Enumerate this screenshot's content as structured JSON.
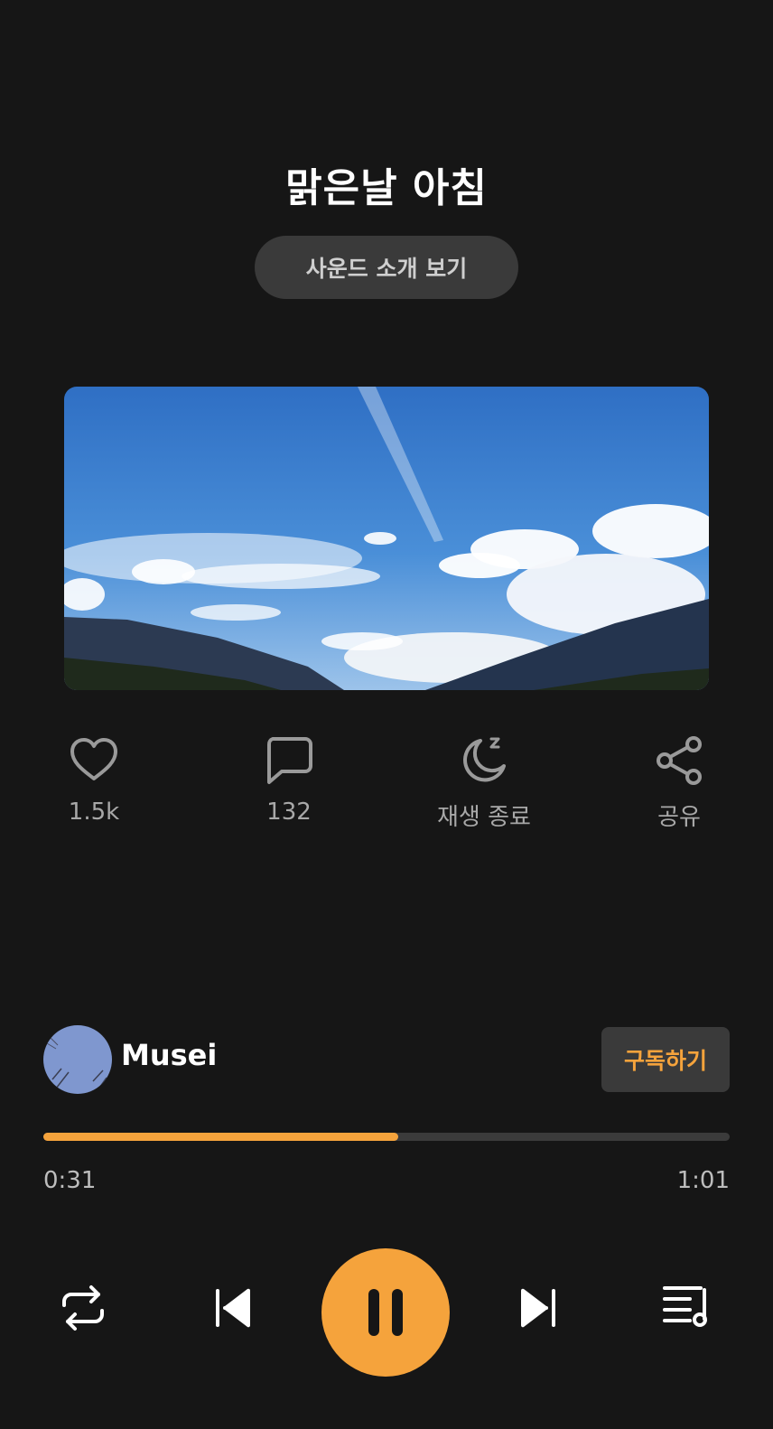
{
  "header": {
    "title": "맑은날 아침",
    "intro_button": "사운드 소개 보기"
  },
  "artwork": {
    "alt": "blue-sky-clouds-mountains-image"
  },
  "actions": [
    {
      "icon": "heart-icon",
      "label": "1.5k"
    },
    {
      "icon": "comment-icon",
      "label": "132"
    },
    {
      "icon": "moon-sleep-icon",
      "label": "재생 종료"
    },
    {
      "icon": "share-icon",
      "label": "공유"
    }
  ],
  "creator": {
    "name": "Musei",
    "subscribe_label": "구독하기"
  },
  "player": {
    "progress_fraction": 0.517,
    "current_time": "0:31",
    "total_time": "1:01",
    "controls": [
      "repeat-icon",
      "previous-icon",
      "pause-icon",
      "next-icon",
      "playlist-icon"
    ]
  },
  "colors": {
    "background": "#161616",
    "accent": "#f5a33c",
    "button_bg": "#3a3a3a"
  }
}
